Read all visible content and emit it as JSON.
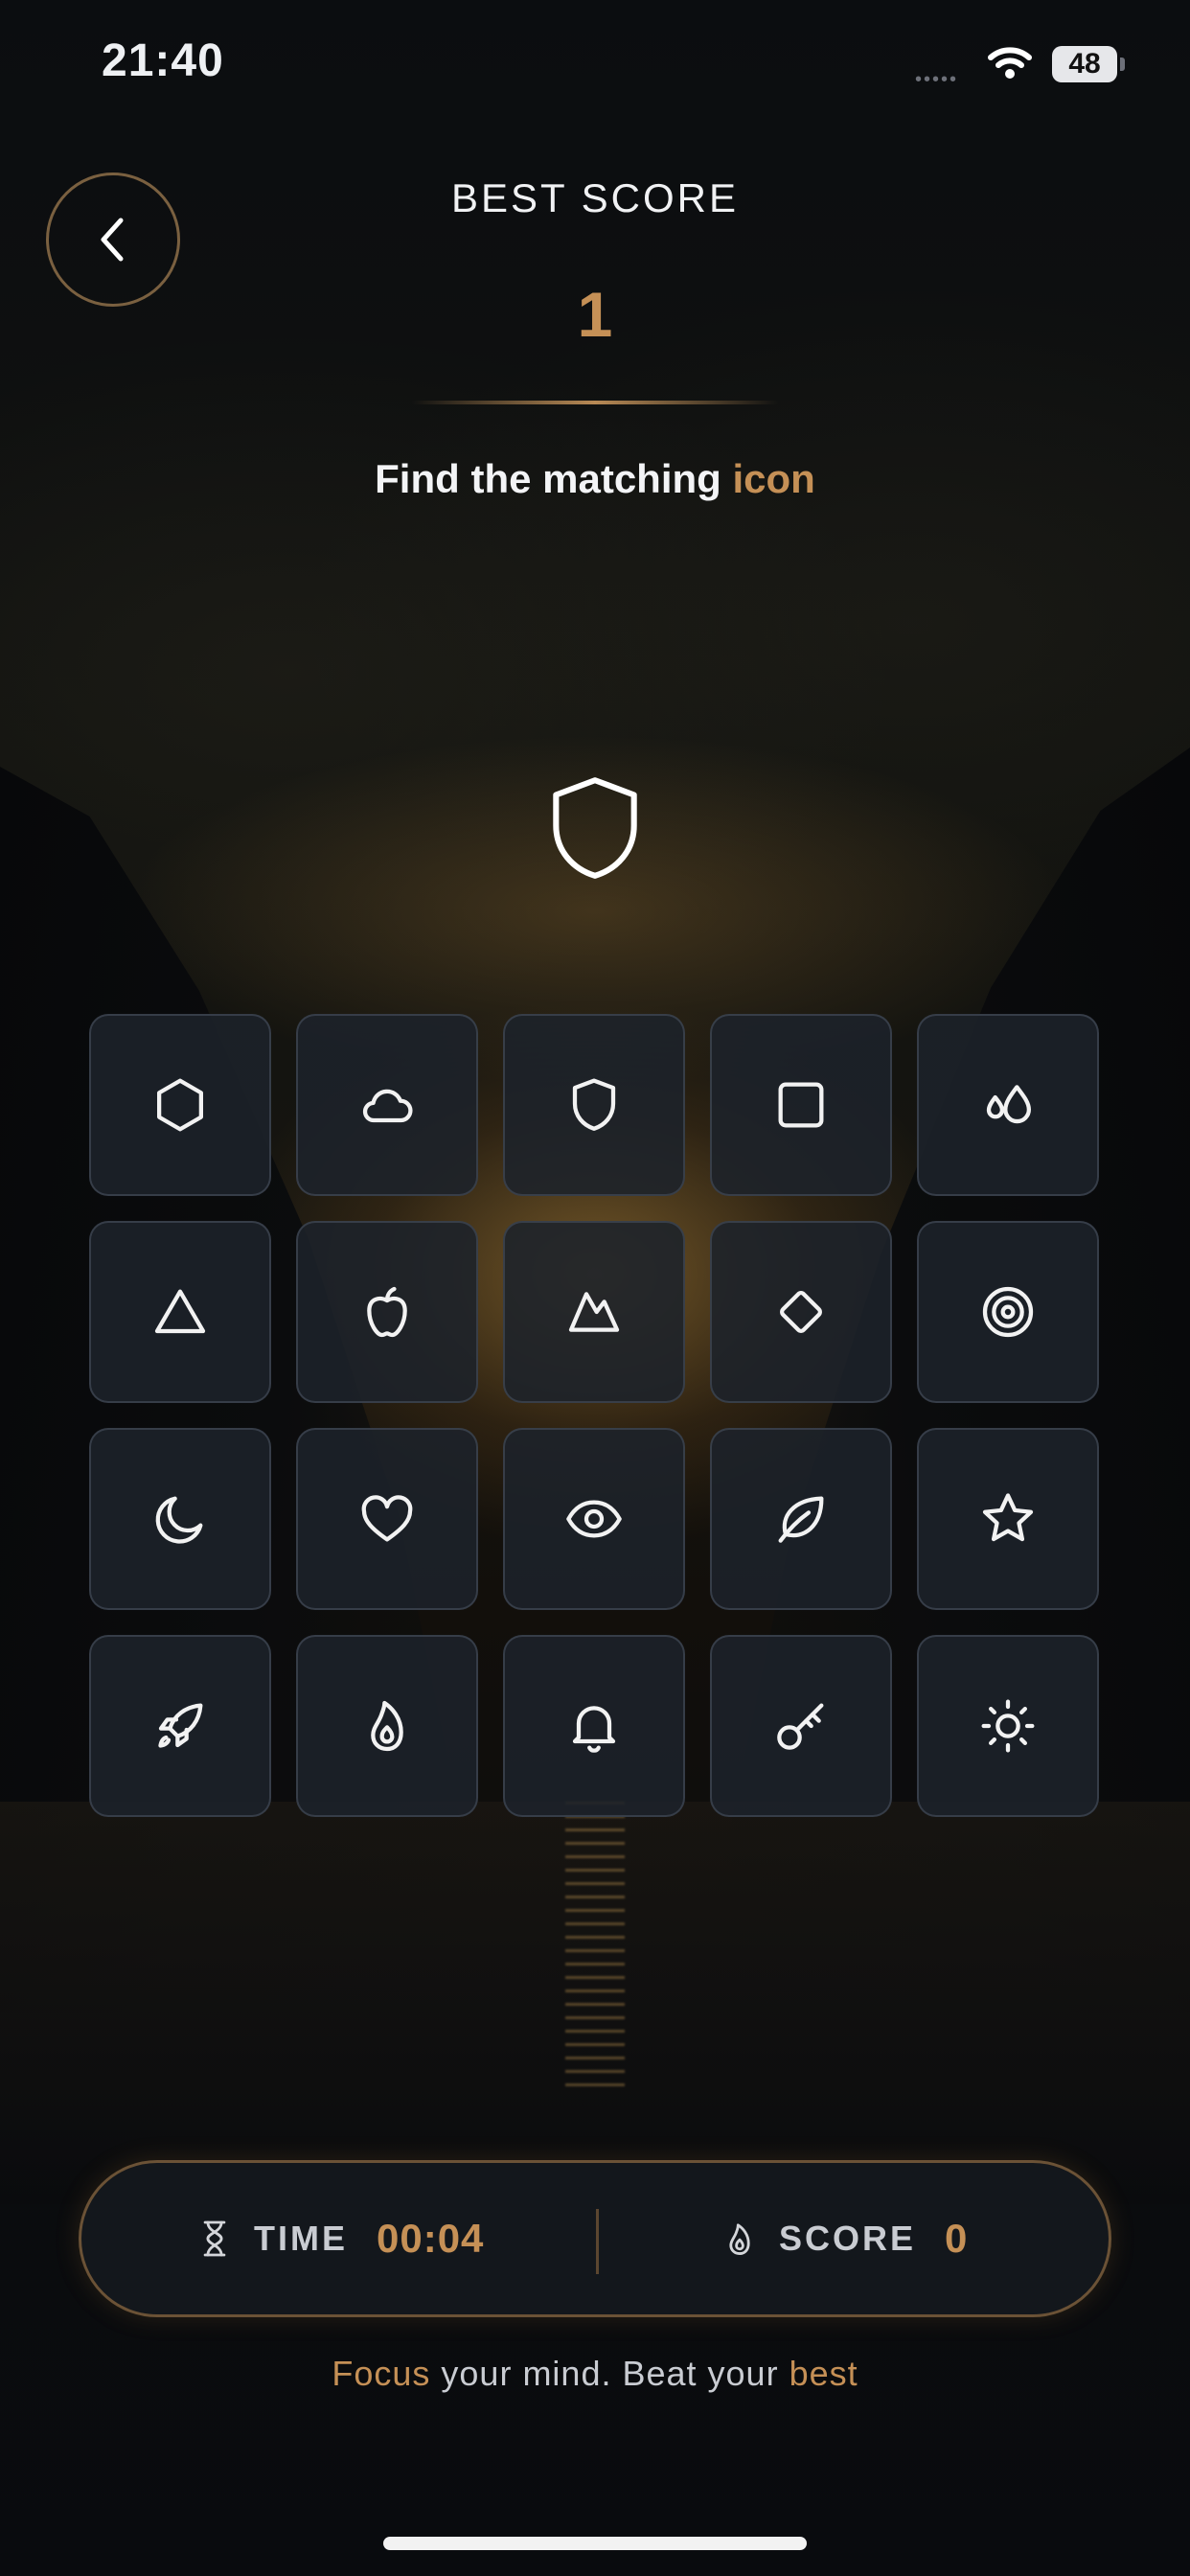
{
  "status_bar": {
    "time": "21:40",
    "battery": "48",
    "signal_dots": "•••••"
  },
  "header": {
    "best_score_label": "BEST SCORE",
    "best_score_value": "1",
    "instruction_prefix": "Find the matching",
    "instruction_accent": "icon"
  },
  "target_icon": "shield-icon",
  "grid": {
    "tiles": [
      "hexagon-icon",
      "cloud-icon",
      "shield-icon",
      "square-icon",
      "droplets-icon",
      "triangle-icon",
      "apple-icon",
      "mountain-icon",
      "diamond-icon",
      "target-icon",
      "moon-icon",
      "heart-icon",
      "eye-icon",
      "leaf-icon",
      "star-icon",
      "rocket-icon",
      "flame-icon",
      "bell-icon",
      "key-icon",
      "sun-icon"
    ]
  },
  "hud": {
    "time_label": "TIME",
    "time_value": "00:04",
    "score_label": "SCORE",
    "score_value": "0"
  },
  "tagline": {
    "part1": "Focus",
    "part2": " your mind. Beat your ",
    "part3": "best"
  },
  "colors": {
    "accent": "#c59056",
    "tile_bg": "#1d222a",
    "icon": "#f2f2f2"
  }
}
